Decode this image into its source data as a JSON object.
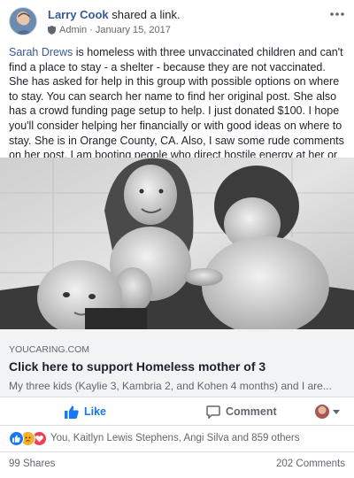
{
  "author": {
    "name": "Larry Cook",
    "action": "shared a link."
  },
  "meta": {
    "role": "Admin",
    "separator": "·",
    "date": "January 15, 2017"
  },
  "post": {
    "mention": "Sarah Drews",
    "text": " is homeless with three unvaccinated children and can't find a place to stay - a shelter - because they are not vaccinated. She has asked for help in this group with possible options on where to stay. You can search her name to find her original post. She also has a crowd funding page setup to help. I just donated $100. I hope you'll consider helping her financially or with good ideas on where to stay. She is in Orange County, CA. Also, I saw some rude comments on her post. I am booting people who direct hostile energy at her or her situation, FYI."
  },
  "link": {
    "domain": "YOUCARING.COM",
    "title": "Click here to support Homeless mother of 3",
    "description": "My three kids (Kaylie 3, Kambria 2, and Kohen 4 months) and I are..."
  },
  "actions": {
    "like": "Like",
    "comment": "Comment"
  },
  "reactions": {
    "summary": "You, Kaitlyn Lewis Stephens, Angi Silva and 859 others"
  },
  "counts": {
    "shares": "99 Shares",
    "comments": "202 Comments"
  },
  "icons": [
    "more-options-icon",
    "shield-icon",
    "like-thumb-icon",
    "comment-icon",
    "like-reaction-icon",
    "sad-reaction-icon",
    "love-reaction-icon",
    "caret-down-icon"
  ],
  "colors": {
    "link_blue": "#385898",
    "like_blue": "#1877f2",
    "muted": "#606770",
    "link_bg": "#f2f3f5"
  }
}
